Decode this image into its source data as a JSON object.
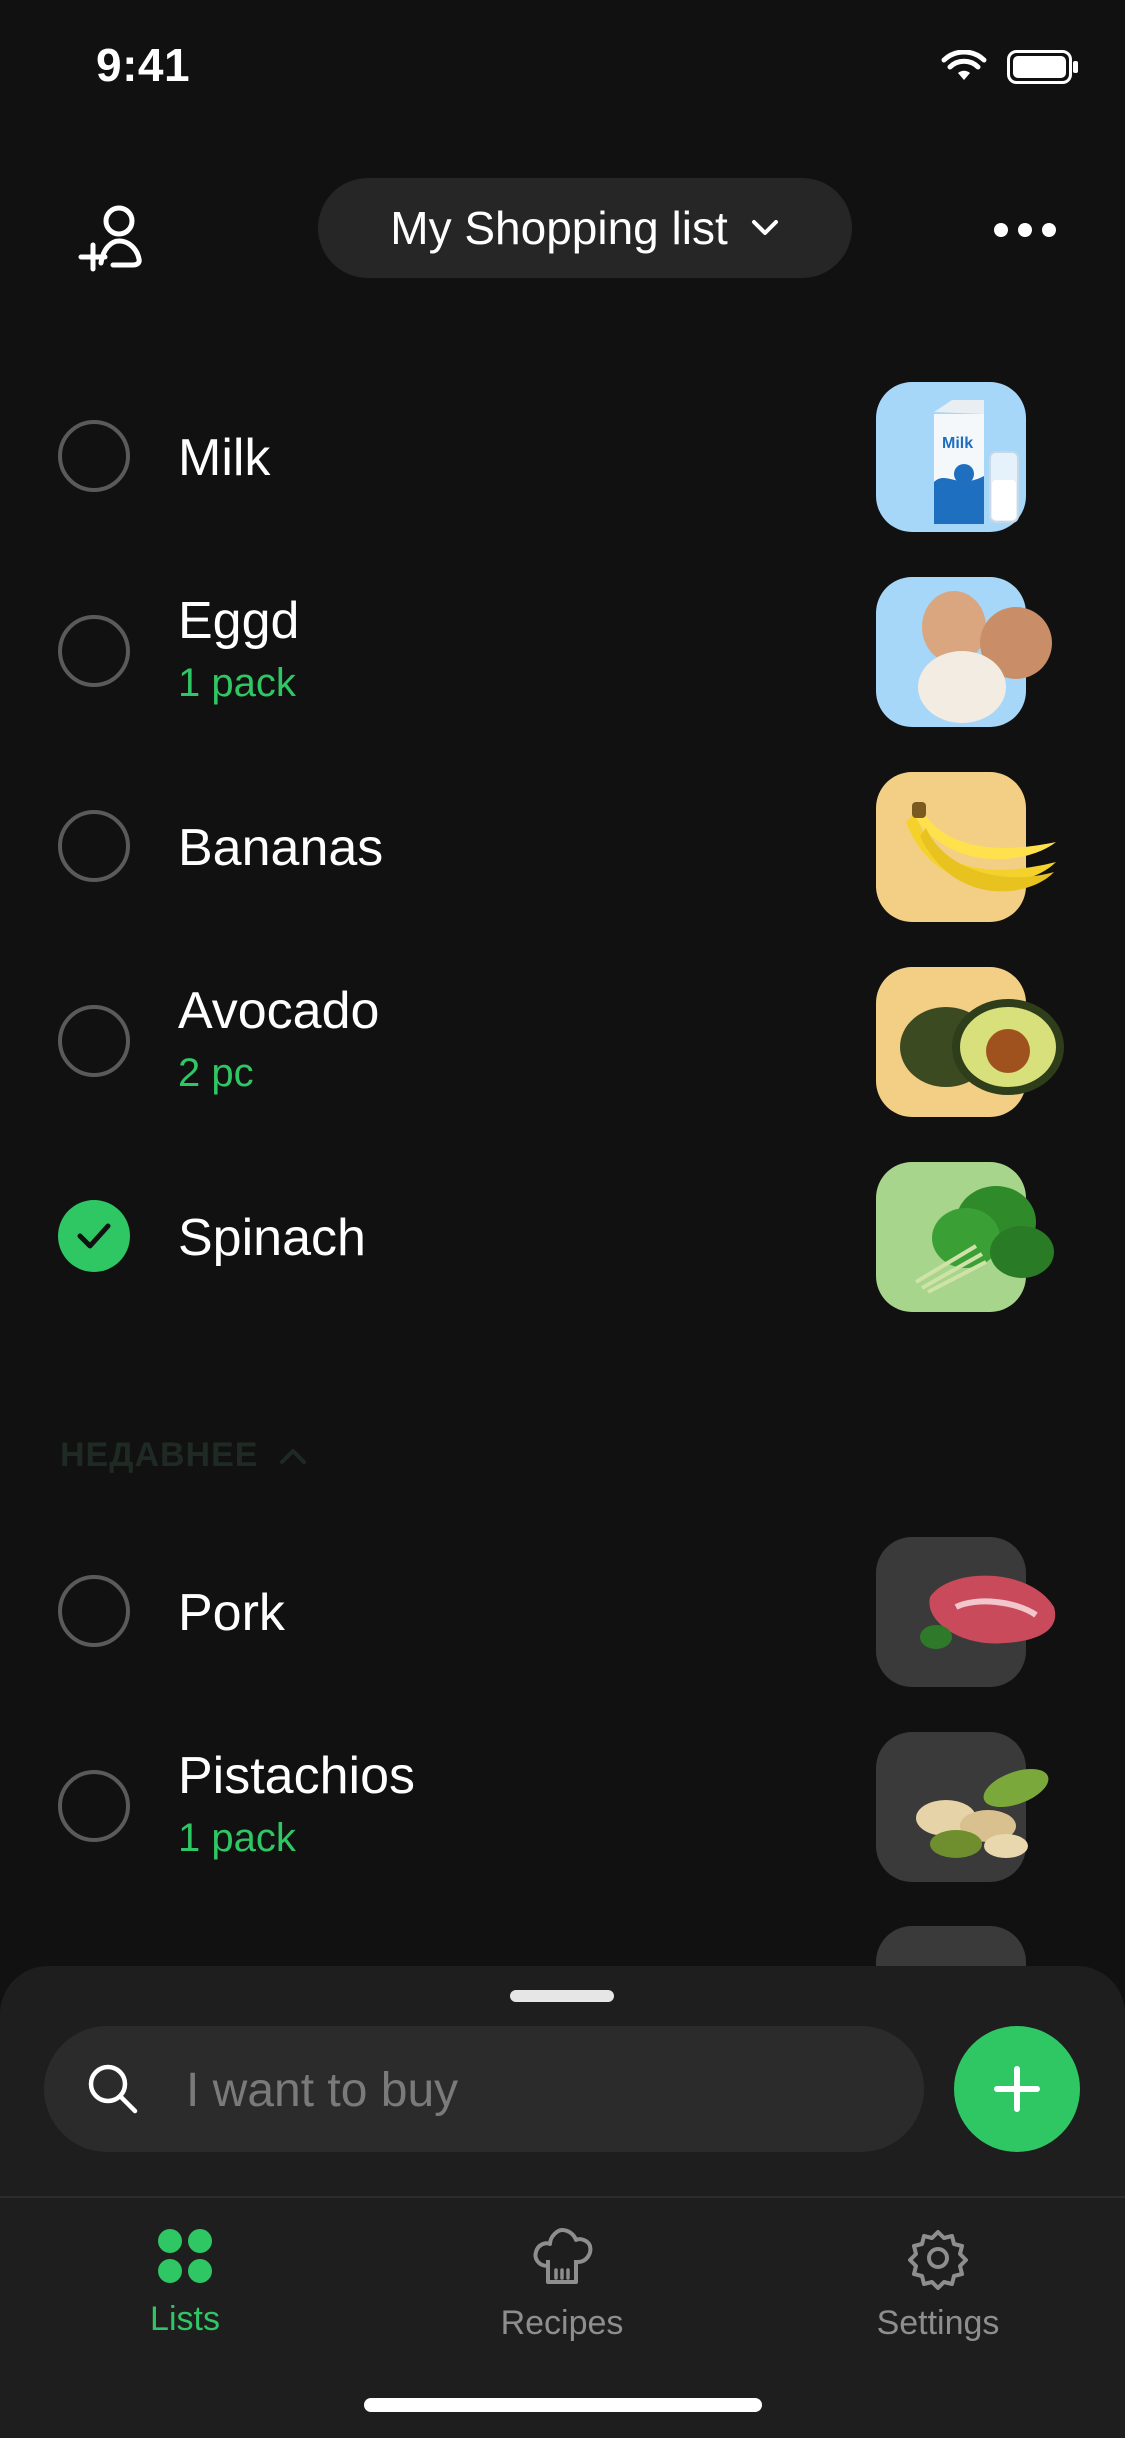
{
  "status": {
    "time": "9:41"
  },
  "header": {
    "list_name": "My Shopping list"
  },
  "items": [
    {
      "name": "Milk",
      "qty": "",
      "checked": false
    },
    {
      "name": "Eggd",
      "qty": "1 pack",
      "checked": false
    },
    {
      "name": "Bananas",
      "qty": "",
      "checked": false
    },
    {
      "name": "Avocado",
      "qty": "2 pc",
      "checked": false
    },
    {
      "name": "Spinach",
      "qty": "",
      "checked": true
    }
  ],
  "recent": {
    "label": "НЕДАВНЕЕ",
    "items": [
      {
        "name": "Pork",
        "qty": ""
      },
      {
        "name": "Pistachios",
        "qty": "1 pack"
      }
    ]
  },
  "search": {
    "placeholder": "I want to buy"
  },
  "tabs": [
    {
      "label": "Lists",
      "active": true
    },
    {
      "label": "Recipes",
      "active": false
    },
    {
      "label": "Settings",
      "active": false
    }
  ],
  "colors": {
    "accent": "#2fc664",
    "background": "#111111",
    "sheet": "#1e1e1e"
  }
}
